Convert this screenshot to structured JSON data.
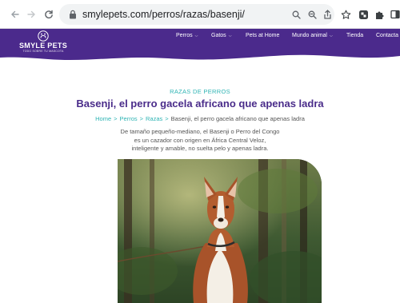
{
  "browser": {
    "url": "smylepets.com/perros/razas/basenji/",
    "back_icon": "arrow-left-icon",
    "forward_icon": "arrow-right-icon",
    "reload_icon": "reload-icon"
  },
  "header": {
    "logo_name": "SMYLE PETS",
    "logo_tagline": "TODO SOBRE TU MASCOTA",
    "background_color": "#4b2a8c",
    "nav": [
      {
        "label": "Perros",
        "has_dropdown": true
      },
      {
        "label": "Gatos",
        "has_dropdown": true
      },
      {
        "label": "Pets at Home",
        "has_dropdown": false
      },
      {
        "label": "Mundo animal",
        "has_dropdown": true
      },
      {
        "label": "Tienda",
        "has_dropdown": false
      },
      {
        "label": "Contacta",
        "has_dropdown": false
      }
    ]
  },
  "article": {
    "eyebrow": "RAZAS DE PERROS",
    "title": "Basenji, el perro gacela africano que apenas ladra",
    "breadcrumb": {
      "items": [
        "Home",
        "Perros",
        "Razas"
      ],
      "separator": ">",
      "current": "Basenji, el perro gacela africano que apenas ladra"
    },
    "intro": "De tamaño pequeño-mediano, el Basenji o Perro del Congo es un cazador con origen en África Central Veloz, inteligente y amable, no suelta pelo y apenas ladra.",
    "accent_color": "#2fb4b4",
    "title_color": "#4a2c8a"
  }
}
